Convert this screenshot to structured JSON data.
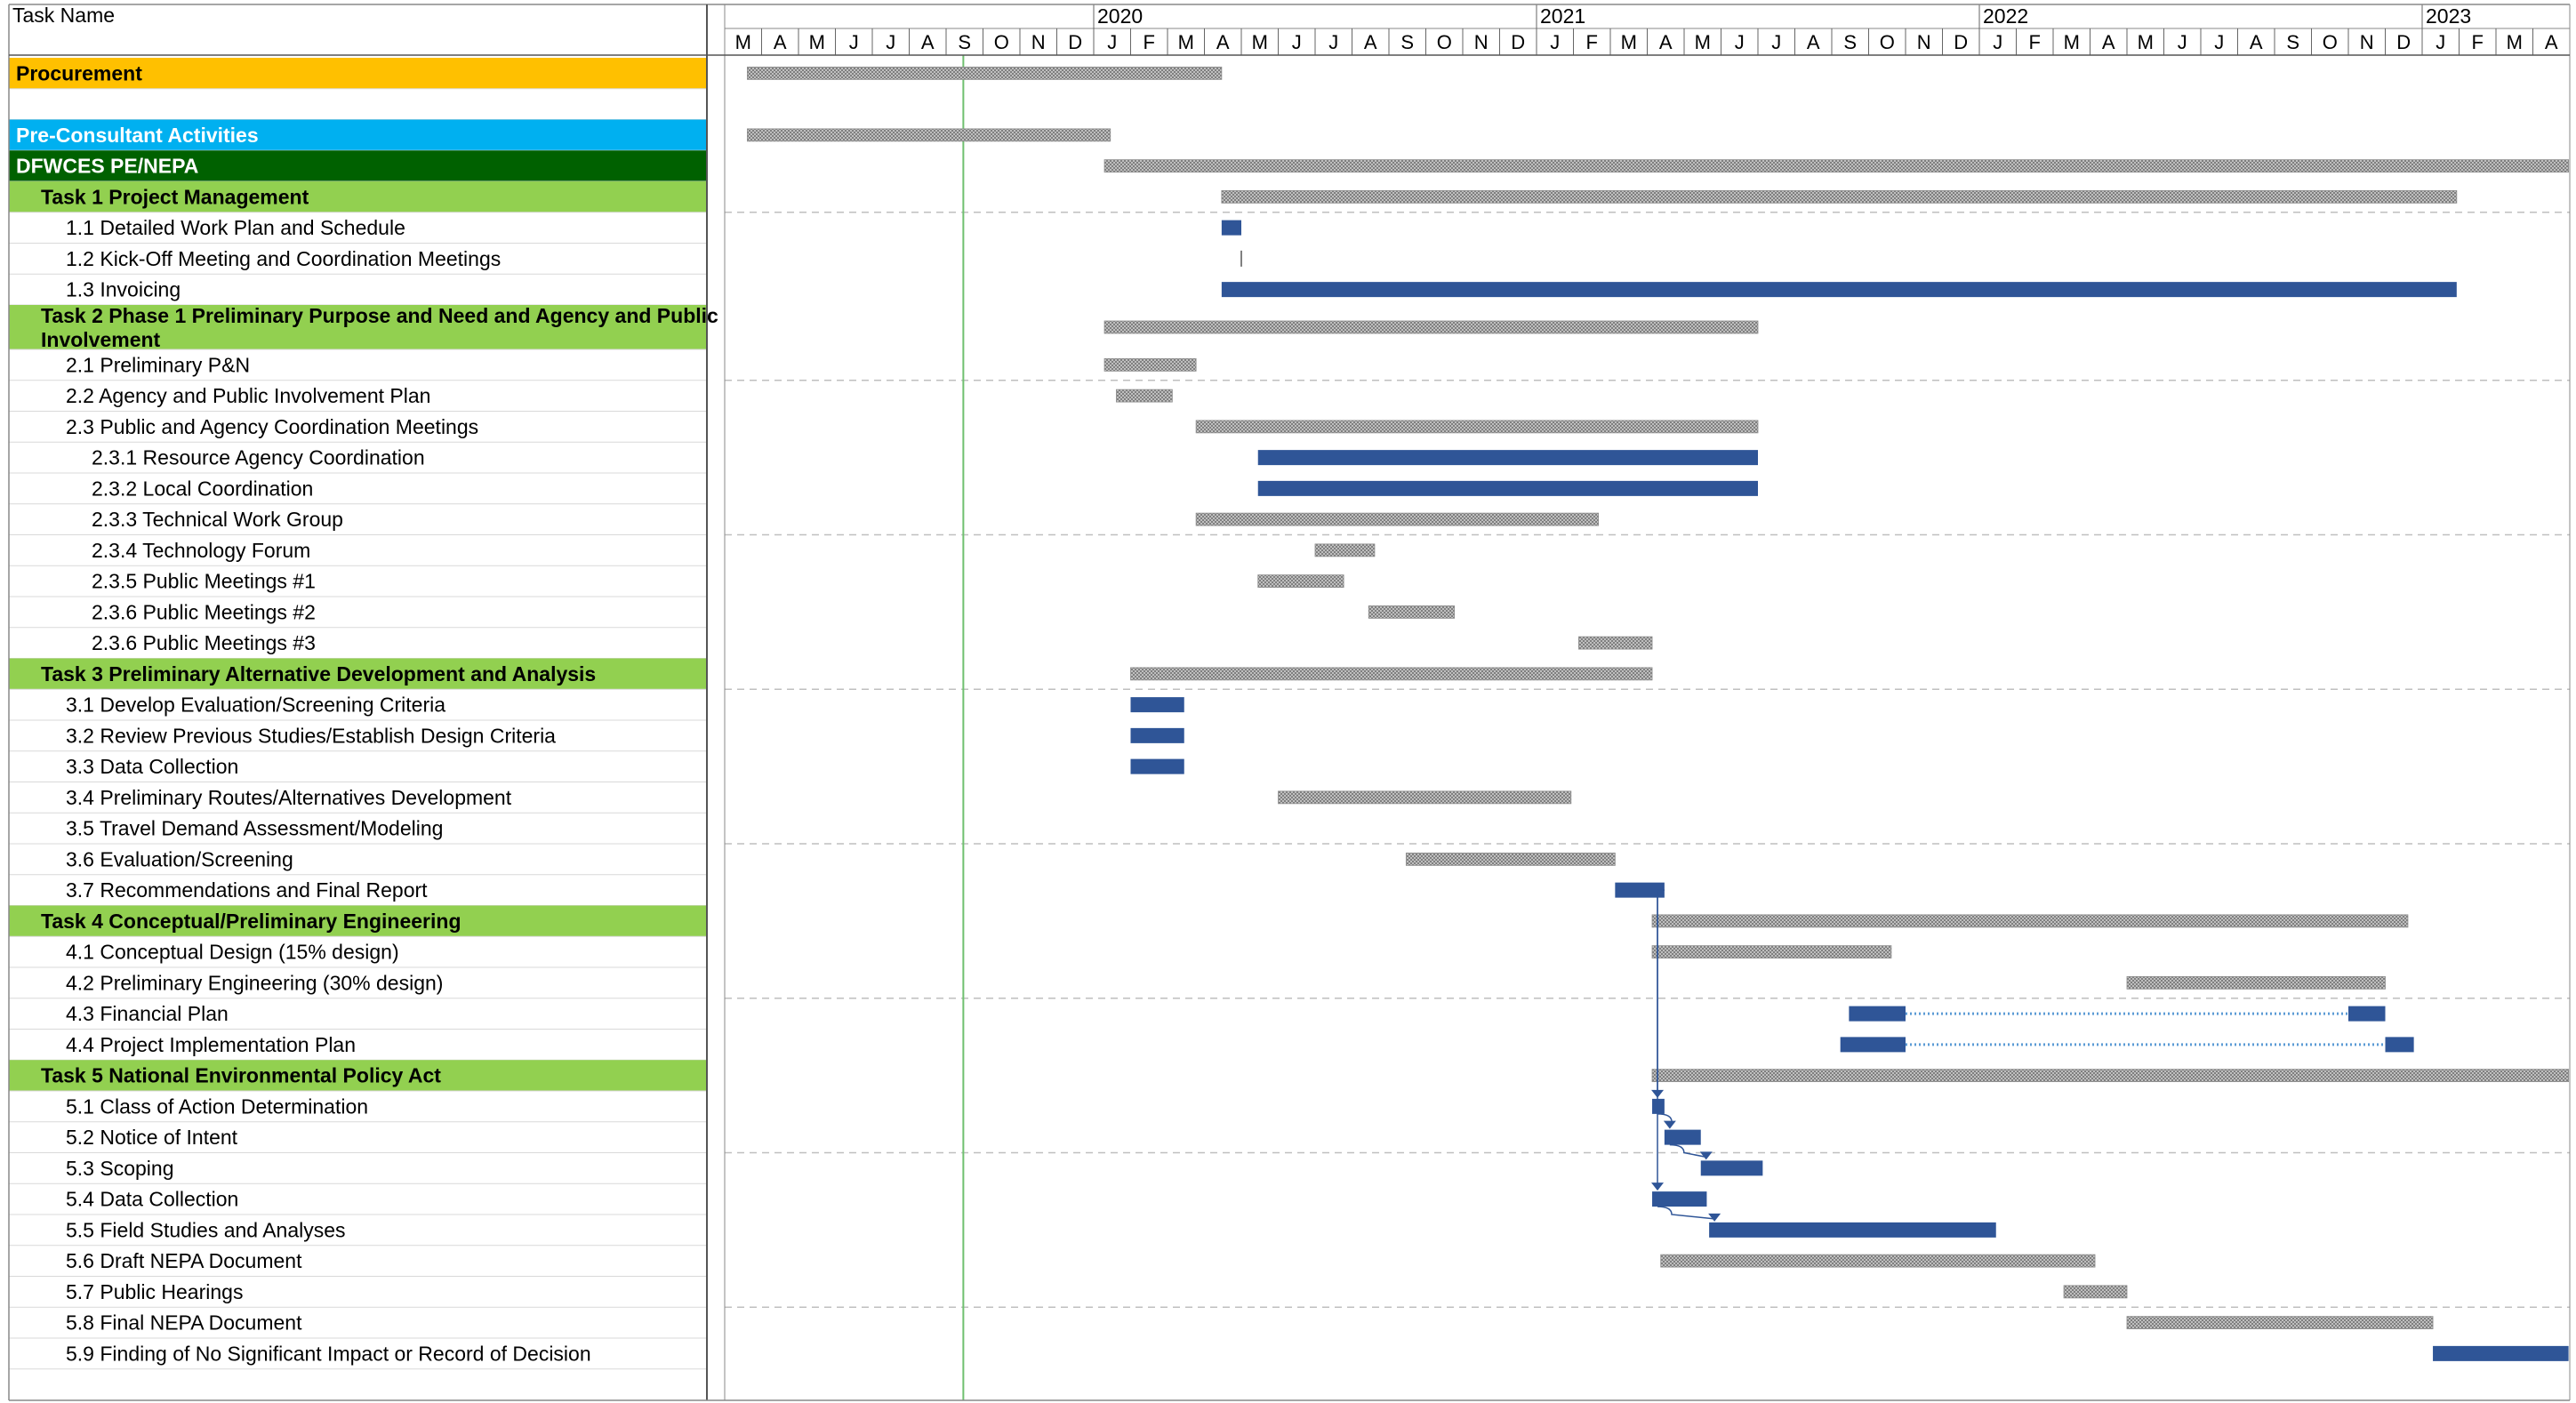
{
  "chart_data": {
    "type": "gantt",
    "title": "",
    "column_header": "Task Name",
    "timeline_start": "2019-03",
    "timeline_end": "2023-04",
    "years": [
      {
        "label": "2020",
        "start": "2020-01"
      },
      {
        "label": "2021",
        "start": "2021-01"
      },
      {
        "label": "2022",
        "start": "2022-01"
      },
      {
        "label": "2023",
        "start": "2023-01"
      }
    ],
    "month_labels": [
      "M",
      "A",
      "M",
      "J",
      "J",
      "A",
      "S",
      "O",
      "N",
      "D",
      "J",
      "F",
      "M",
      "A",
      "M",
      "J",
      "J",
      "A",
      "S",
      "O",
      "N",
      "D",
      "J",
      "F",
      "M",
      "A",
      "M",
      "J",
      "J",
      "A",
      "S",
      "O",
      "N",
      "D",
      "J",
      "F",
      "M",
      "A",
      "M",
      "J",
      "J",
      "A",
      "S",
      "O",
      "N",
      "D",
      "J",
      "F",
      "M",
      "A"
    ],
    "today_marker": "2019-09-15",
    "colors": {
      "procurement": "#FFC000",
      "pre_consultant": "#00B0F0",
      "program": "#006100",
      "task_group": "#92D050",
      "blue_bar": "#2F5597",
      "hatched_bar": "#A6A6A6",
      "today_line": "#70C070",
      "link_line": "#2F5597"
    },
    "tasks": [
      {
        "name": "Procurement",
        "style": "procurement",
        "bars": [
          {
            "start": "2019-03-20",
            "end": "2020-04-15",
            "kind": "hatched"
          }
        ]
      },
      {
        "name": "",
        "style": "blank",
        "bars": []
      },
      {
        "name": "Pre-Consultant Activities",
        "style": "pre_consultant",
        "bars": [
          {
            "start": "2019-03-20",
            "end": "2020-01-15",
            "kind": "hatched"
          }
        ]
      },
      {
        "name": "DFWCES PE/NEPA",
        "style": "program",
        "bars": [
          {
            "start": "2020-01-10",
            "end": "2023-04-30",
            "kind": "hatched"
          }
        ]
      },
      {
        "name": "Task 1 Project Management",
        "style": "task_group",
        "bars": [
          {
            "start": "2020-04-15",
            "end": "2023-01-30",
            "kind": "hatched"
          }
        ]
      },
      {
        "name": "1.1 Detailed Work Plan and Schedule",
        "style": "subtask",
        "bars": [
          {
            "start": "2020-04-15",
            "end": "2020-05-01",
            "kind": "blue"
          }
        ]
      },
      {
        "name": "1.2 Kick-Off Meeting and Coordination Meetings",
        "style": "subtask",
        "bars": [
          {
            "start": "2020-05-01",
            "end": "2020-05-01",
            "kind": "milestone"
          }
        ]
      },
      {
        "name": "1.3 Invoicing",
        "style": "subtask",
        "bars": [
          {
            "start": "2020-04-15",
            "end": "2023-01-30",
            "kind": "blue"
          }
        ]
      },
      {
        "name": "Task 2 Phase 1 Preliminary Purpose and Need and Agency and Public Involvement",
        "style": "task_group",
        "bars": [
          {
            "start": "2020-01-10",
            "end": "2021-07-01",
            "kind": "hatched"
          }
        ]
      },
      {
        "name": "2.1 Preliminary P&N",
        "style": "subtask",
        "bars": [
          {
            "start": "2020-01-10",
            "end": "2020-03-25",
            "kind": "hatched"
          }
        ]
      },
      {
        "name": "2.2 Agency and Public Involvement Plan",
        "style": "subtask",
        "bars": [
          {
            "start": "2020-01-20",
            "end": "2020-03-05",
            "kind": "hatched"
          }
        ]
      },
      {
        "name": "2.3 Public and Agency Coordination Meetings",
        "style": "subtask",
        "bars": [
          {
            "start": "2020-03-25",
            "end": "2021-07-01",
            "kind": "hatched"
          }
        ]
      },
      {
        "name": "2.3.1 Resource Agency Coordination",
        "style": "subsub",
        "bars": [
          {
            "start": "2020-05-15",
            "end": "2021-07-01",
            "kind": "blue"
          }
        ]
      },
      {
        "name": "2.3.2 Local Coordination",
        "style": "subsub",
        "bars": [
          {
            "start": "2020-05-15",
            "end": "2021-07-01",
            "kind": "blue"
          }
        ]
      },
      {
        "name": "2.3.3 Technical Work Group",
        "style": "subsub",
        "bars": [
          {
            "start": "2020-03-25",
            "end": "2021-02-20",
            "kind": "hatched"
          }
        ]
      },
      {
        "name": "2.3.4 Technology Forum",
        "style": "subsub",
        "bars": [
          {
            "start": "2020-07-01",
            "end": "2020-08-20",
            "kind": "hatched"
          }
        ]
      },
      {
        "name": "2.3.5 Public Meetings #1",
        "style": "subsub",
        "bars": [
          {
            "start": "2020-05-15",
            "end": "2020-07-25",
            "kind": "hatched"
          }
        ]
      },
      {
        "name": "2.3.6 Public Meetings #2",
        "style": "subsub",
        "bars": [
          {
            "start": "2020-08-15",
            "end": "2020-10-25",
            "kind": "hatched"
          }
        ]
      },
      {
        "name": "2.3.6 Public Meetings #3",
        "style": "subsub",
        "bars": [
          {
            "start": "2021-02-05",
            "end": "2021-04-05",
            "kind": "hatched"
          }
        ]
      },
      {
        "name": "Task 3 Preliminary Alternative Development and Analysis",
        "style": "task_group",
        "bars": [
          {
            "start": "2020-02-01",
            "end": "2021-04-05",
            "kind": "hatched"
          }
        ]
      },
      {
        "name": "3.1 Develop Evaluation/Screening Criteria",
        "style": "subtask",
        "bars": [
          {
            "start": "2020-02-01",
            "end": "2020-03-15",
            "kind": "blue"
          }
        ]
      },
      {
        "name": "3.2 Review Previous Studies/Establish Design Criteria",
        "style": "subtask",
        "bars": [
          {
            "start": "2020-02-01",
            "end": "2020-03-15",
            "kind": "blue"
          }
        ]
      },
      {
        "name": "3.3 Data Collection",
        "style": "subtask",
        "bars": [
          {
            "start": "2020-02-01",
            "end": "2020-03-15",
            "kind": "blue"
          }
        ]
      },
      {
        "name": "3.4 Preliminary Routes/Alternatives Development",
        "style": "subtask",
        "bars": [
          {
            "start": "2020-06-01",
            "end": "2021-01-30",
            "kind": "hatched"
          }
        ]
      },
      {
        "name": "3.5 Travel Demand Assessment/Modeling",
        "style": "subtask",
        "bars": []
      },
      {
        "name": "3.6 Evaluation/Screening",
        "style": "subtask",
        "bars": [
          {
            "start": "2020-09-15",
            "end": "2021-03-05",
            "kind": "hatched"
          }
        ]
      },
      {
        "name": "3.7 Recommendations and Final Report",
        "style": "subtask",
        "bars": [
          {
            "start": "2021-03-05",
            "end": "2021-04-15",
            "kind": "blue"
          }
        ]
      },
      {
        "name": "Task 4 Conceptual/Preliminary Engineering",
        "style": "task_group",
        "bars": [
          {
            "start": "2021-04-05",
            "end": "2022-12-20",
            "kind": "hatched"
          }
        ]
      },
      {
        "name": "4.1 Conceptual Design (15% design)",
        "style": "subtask",
        "bars": [
          {
            "start": "2021-04-05",
            "end": "2021-10-20",
            "kind": "hatched"
          }
        ]
      },
      {
        "name": "4.2 Preliminary Engineering (30% design)",
        "style": "subtask",
        "bars": [
          {
            "start": "2022-05-01",
            "end": "2022-12-01",
            "kind": "hatched"
          }
        ]
      },
      {
        "name": "4.3 Financial Plan",
        "style": "subtask",
        "bars": [
          {
            "start": "2021-09-15",
            "end": "2021-11-01",
            "kind": "blue"
          },
          {
            "start": "2021-11-01",
            "end": "2022-11-01",
            "kind": "dotted"
          },
          {
            "start": "2022-11-01",
            "end": "2022-12-01",
            "kind": "blue"
          }
        ]
      },
      {
        "name": "4.4 Project Implementation Plan",
        "style": "subtask",
        "bars": [
          {
            "start": "2021-09-08",
            "end": "2021-11-01",
            "kind": "blue"
          },
          {
            "start": "2021-11-01",
            "end": "2022-12-01",
            "kind": "dotted"
          },
          {
            "start": "2022-12-01",
            "end": "2022-12-25",
            "kind": "blue"
          }
        ]
      },
      {
        "name": "Task 5 National Environmental Policy Act",
        "style": "task_group",
        "bars": [
          {
            "start": "2021-04-05",
            "end": "2023-04-30",
            "kind": "hatched"
          }
        ]
      },
      {
        "name": "5.1 Class of Action Determination",
        "style": "subtask",
        "bars": [
          {
            "start": "2021-04-05",
            "end": "2021-04-15",
            "kind": "blue"
          }
        ]
      },
      {
        "name": "5.2 Notice of Intent",
        "style": "subtask",
        "bars": [
          {
            "start": "2021-04-15",
            "end": "2021-05-15",
            "kind": "blue"
          }
        ]
      },
      {
        "name": "5.3 Scoping",
        "style": "subtask",
        "bars": [
          {
            "start": "2021-05-15",
            "end": "2021-07-05",
            "kind": "blue"
          }
        ]
      },
      {
        "name": "5.4 Data Collection",
        "style": "subtask",
        "bars": [
          {
            "start": "2021-04-05",
            "end": "2021-05-20",
            "kind": "blue"
          }
        ]
      },
      {
        "name": "5.5 Field Studies and Analyses",
        "style": "subtask",
        "bars": [
          {
            "start": "2021-05-22",
            "end": "2022-01-15",
            "kind": "blue"
          }
        ]
      },
      {
        "name": "5.6 Draft NEPA Document",
        "style": "subtask",
        "bars": [
          {
            "start": "2021-04-12",
            "end": "2022-04-05",
            "kind": "hatched"
          }
        ]
      },
      {
        "name": "5.7 Public Hearings",
        "style": "subtask",
        "bars": [
          {
            "start": "2022-03-10",
            "end": "2022-05-01",
            "kind": "hatched"
          }
        ]
      },
      {
        "name": "5.8 Final NEPA Document",
        "style": "subtask",
        "bars": [
          {
            "start": "2022-05-01",
            "end": "2023-01-10",
            "kind": "hatched"
          }
        ]
      },
      {
        "name": "5.9 Finding of No Significant Impact or Record of Decision",
        "style": "subtask",
        "bars": [
          {
            "start": "2023-01-10",
            "end": "2023-04-30",
            "kind": "blue"
          }
        ]
      }
    ],
    "dependencies": [
      {
        "from": 26,
        "to": 33
      },
      {
        "from": 26,
        "to": 36
      },
      {
        "from": 33,
        "to": 34
      },
      {
        "from": 34,
        "to": 35
      },
      {
        "from": 36,
        "to": 37
      }
    ]
  }
}
